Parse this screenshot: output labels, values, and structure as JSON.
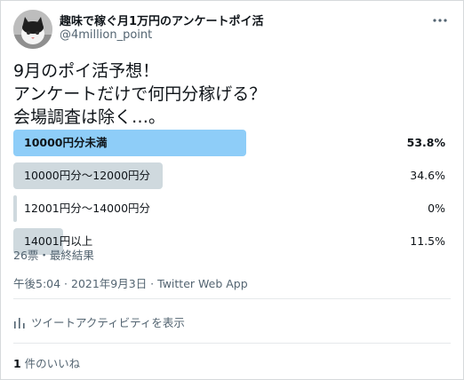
{
  "author": {
    "name": "趣味で稼ぐ月1万円のアンケートポイ活",
    "handle": "@4million_point"
  },
  "tweet": {
    "text": "9月のポイ活予想！\nアンケートだけで何円分稼げる？\n会場調査は除く…。"
  },
  "poll": {
    "options": [
      {
        "label": "10000円分未満",
        "percent_text": "53.8%",
        "percent": 53.8,
        "winner": true
      },
      {
        "label": "10000円分～12000円分",
        "percent_text": "34.6%",
        "percent": 34.6,
        "winner": false
      },
      {
        "label": "12001円分～14000円分",
        "percent_text": "0%",
        "percent": 0,
        "winner": false
      },
      {
        "label": "14001円以上",
        "percent_text": "11.5%",
        "percent": 11.5,
        "winner": false
      }
    ],
    "meta": "26票・最終結果"
  },
  "timestamp": "午後5:04 · 2021年9月3日 · Twitter Web App",
  "activity_label": "ツイートアクティビティを表示",
  "likes": {
    "count": "1",
    "label": " 件のいいね"
  },
  "colors": {
    "winner_bar": "#8ecdf8",
    "other_bar": "#cfd9de",
    "text": "#0f1419",
    "secondary": "#536471"
  },
  "icons": [
    "avatar-cat-photo",
    "more-icon",
    "activity-chart-icon"
  ]
}
